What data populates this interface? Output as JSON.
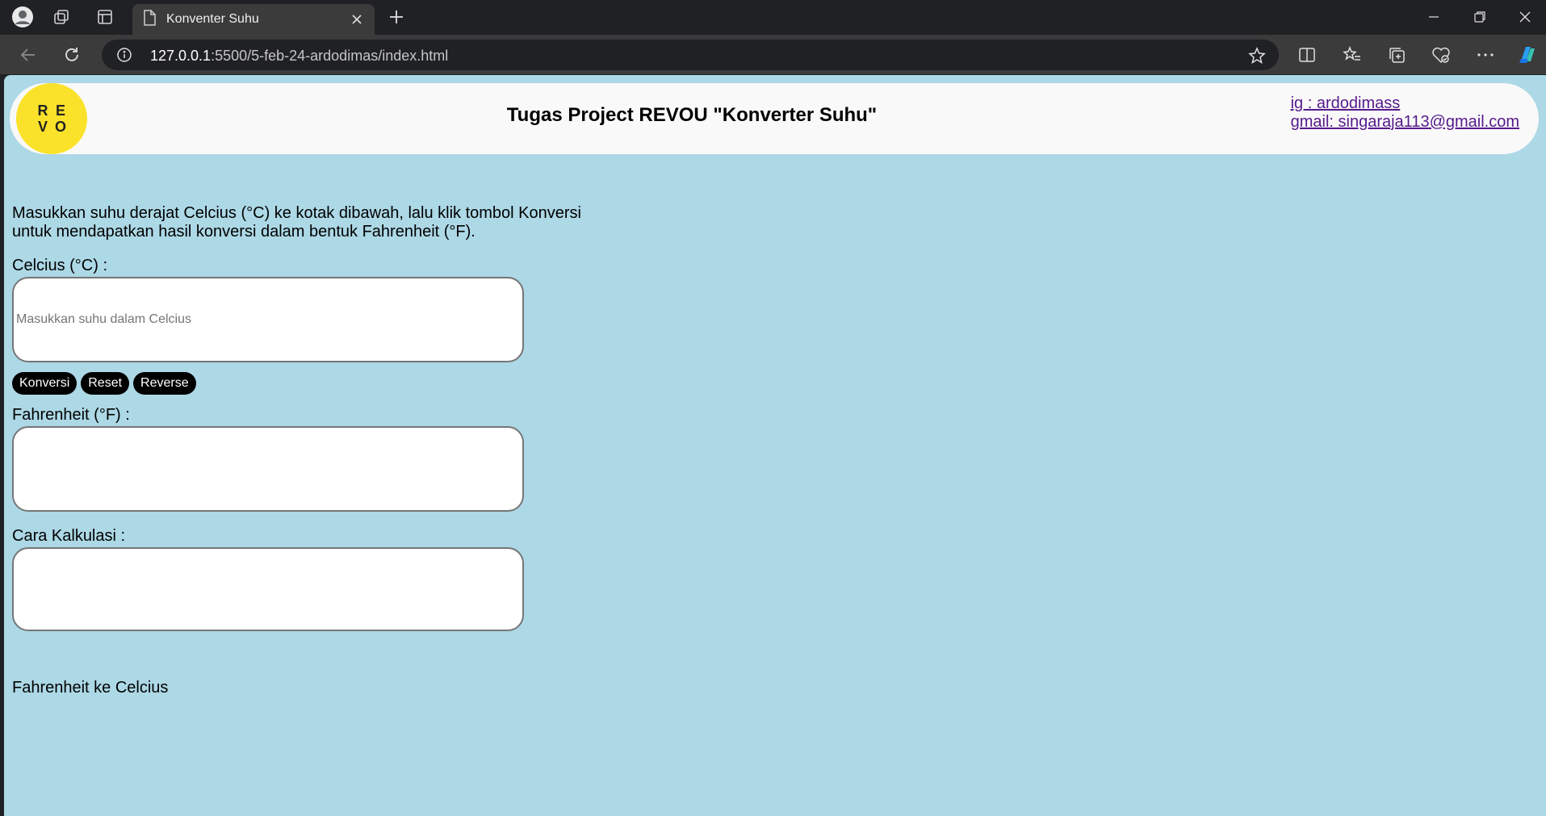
{
  "browser": {
    "tab_title": "Konventer Suhu",
    "url_host": "127.0.0.1",
    "url_rest": ":5500/5-feb-24-ardodimas/index.html"
  },
  "header": {
    "logo_letters": [
      "R",
      "E",
      "V",
      "O"
    ],
    "title": "Tugas Project REVOU \"Konverter Suhu\"",
    "instagram": "ig : ardodimass",
    "gmail": "gmail: singaraja113@gmail.com"
  },
  "main": {
    "intro": "Masukkan suhu derajat Celcius (°C) ke kotak dibawah, lalu klik tombol Konversi untuk mendapatkan hasil konversi dalam bentuk Fahrenheit (°F).",
    "celcius_label": "Celcius (°C) :",
    "celcius_placeholder": "Masukkan suhu dalam Celcius",
    "buttons": {
      "convert": "Konversi",
      "reset": "Reset",
      "reverse": "Reverse"
    },
    "fahrenheit_label": "Fahrenheit (°F) :",
    "calc_label": "Cara Kalkulasi :",
    "footer_text": "Fahrenheit ke Celcius"
  },
  "colors": {
    "page_bg": "#add8e6",
    "header_bg": "#f9f9f9",
    "logo_bg": "#fbe22a",
    "button_bg": "#000000"
  }
}
